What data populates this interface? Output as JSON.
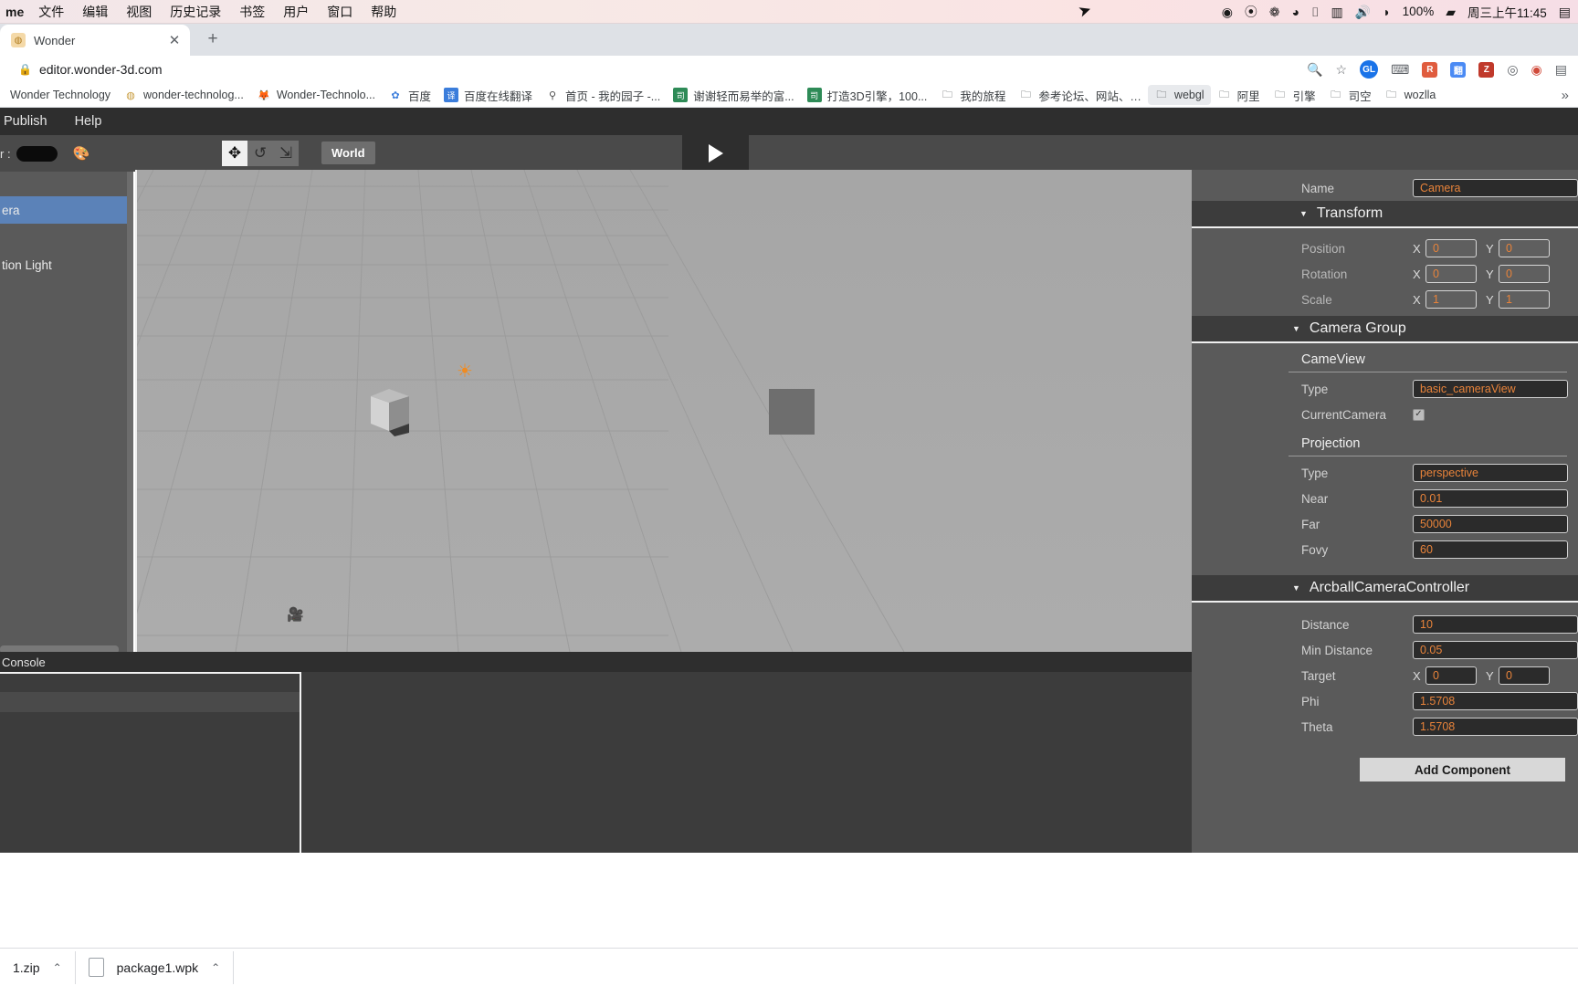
{
  "os_menubar": {
    "app_name": "me",
    "menus": [
      "文件",
      "编辑",
      "视图",
      "历史记录",
      "书签",
      "用户",
      "窗口",
      "帮助"
    ],
    "status_icons": [
      "record-icon",
      "camera-icon",
      "wechat-icon",
      "shield-icon",
      "airplay-icon",
      "battery-widget-icon",
      "volume-icon",
      "wifi-icon"
    ],
    "battery_percent": "100%",
    "clock": "周三上午11:45"
  },
  "browser": {
    "tab": {
      "title": "Wonder",
      "close_label": "✕"
    },
    "new_tab_label": "+",
    "address": "editor.wonder-3d.com",
    "lock_icon": "🔒",
    "toolbar_icons": [
      "search-icon",
      "star-icon"
    ],
    "profile_initials": "GL",
    "extensions": [
      "R",
      "翻",
      "Z",
      "compass-icon",
      "badge-icon"
    ],
    "bookmarks": [
      {
        "label": "Wonder Technology",
        "icon": ""
      },
      {
        "label": "wonder-technolog...",
        "icon": "wonder-icon"
      },
      {
        "label": "Wonder-Technolo...",
        "icon": "firefox-icon"
      },
      {
        "label": "百度",
        "icon": "baidu-icon"
      },
      {
        "label": "百度在线翻译",
        "icon": "translate-icon"
      },
      {
        "label": "首页 - 我的园子 -...",
        "icon": "cnblogs-icon"
      },
      {
        "label": "谢谢轻而易举的富...",
        "icon": "doc-icon"
      },
      {
        "label": "打造3D引擎，100...",
        "icon": "doc-icon"
      },
      {
        "label": "我的旅程",
        "icon": "folder-icon"
      },
      {
        "label": "参考论坛、网站、…",
        "icon": "folder-icon"
      },
      {
        "label": "webgl",
        "icon": "folder-icon"
      },
      {
        "label": "阿里",
        "icon": "folder-icon"
      },
      {
        "label": "引擎",
        "icon": "folder-icon"
      },
      {
        "label": "司空",
        "icon": "folder-icon"
      },
      {
        "label": "wozlla",
        "icon": "folder-icon"
      }
    ],
    "bookmarks_overflow": "»",
    "downloads": [
      {
        "name": "1.zip",
        "caret": "⌃"
      },
      {
        "name": "package1.wpk",
        "caret": "⌃"
      }
    ]
  },
  "editor": {
    "menu": [
      "Publish",
      "Help"
    ],
    "toolbar": {
      "color_label": "r :",
      "palette_icon": "palette-icon",
      "gizmos": [
        {
          "name": "translate-gizmo",
          "glyph": "✥",
          "active": true
        },
        {
          "name": "rotate-gizmo",
          "glyph": "↺",
          "active": false
        },
        {
          "name": "scale-gizmo",
          "glyph": "⇲",
          "active": false
        }
      ],
      "space_mode": "World",
      "play_button": "play-icon"
    },
    "hierarchy": {
      "items": [
        {
          "label": "era",
          "selected": true
        },
        {
          "label": "tion Light",
          "selected": false
        }
      ]
    },
    "console": {
      "title": "Console"
    },
    "inspector": {
      "name_label": "Name",
      "name_value": "Camera",
      "transform": {
        "title": "Transform",
        "caret": "▼",
        "rows": [
          {
            "label": "Position",
            "x": "0",
            "y": "0"
          },
          {
            "label": "Rotation",
            "x": "0",
            "y": "0"
          },
          {
            "label": "Scale",
            "x": "1",
            "y": "1"
          }
        ]
      },
      "camera_group": {
        "title": "Camera Group",
        "caret": "▼",
        "cameview": {
          "title": "CameView",
          "type_label": "Type",
          "type_value": "basic_cameraView",
          "current_camera_label": "CurrentCamera",
          "current_camera_checked": true
        },
        "projection": {
          "title": "Projection",
          "rows": [
            {
              "label": "Type",
              "value": "perspective"
            },
            {
              "label": "Near",
              "value": "0.01"
            },
            {
              "label": "Far",
              "value": "50000"
            },
            {
              "label": "Fovy",
              "value": "60"
            }
          ]
        }
      },
      "arcball": {
        "title": "ArcballCameraController",
        "caret": "▼",
        "rows": [
          {
            "label": "Distance",
            "value": "10"
          },
          {
            "label": "Min Distance",
            "value": "0.05"
          },
          {
            "label": "Phi",
            "value": "1.5708"
          },
          {
            "label": "Theta",
            "value": "1.5708"
          }
        ],
        "target": {
          "label": "Target",
          "x": "0",
          "y": "0"
        }
      },
      "add_component_label": "Add Component"
    }
  },
  "colors": {
    "accent_orange": "#e8833a",
    "selection_blue": "#5b82b8",
    "panel_grey": "#5a5a5a",
    "dark_grey": "#3c3c3c",
    "viewport_grey": "#a8a8a8"
  }
}
